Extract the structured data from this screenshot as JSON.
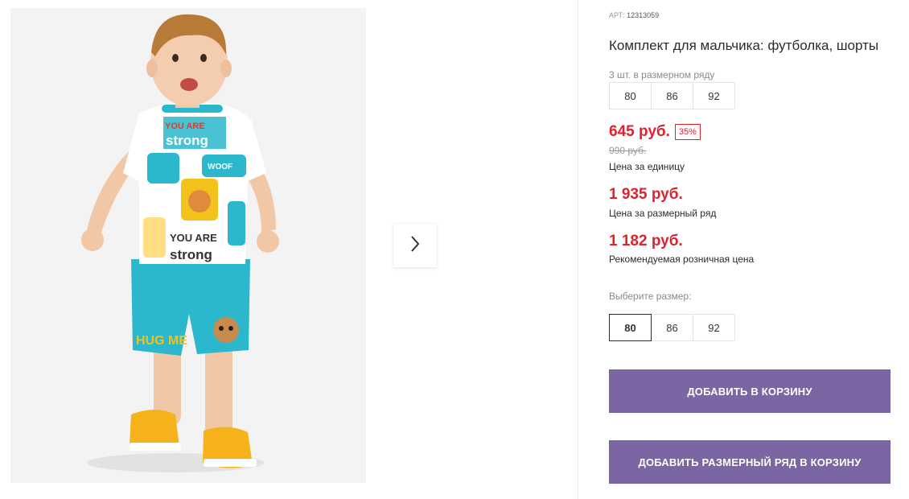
{
  "product": {
    "sku_label": "АРТ:",
    "sku_value": "12313059",
    "title": "Комплект для мальчика: футболка, шорты",
    "pack_note": "3 шт. в размерном ряду",
    "pack_sizes": [
      "80",
      "86",
      "92"
    ],
    "price": "645 руб.",
    "discount": "35%",
    "old_price": "990 руб.",
    "unit_caption": "Цена за единицу",
    "row_price": "1 935 руб.",
    "row_caption": "Цена за размерный ряд",
    "retail_price": "1 182 руб.",
    "retail_caption": "Рекомендуемая розничная цена",
    "choose_size_label": "Выберите размер:",
    "size_options": [
      "80",
      "86",
      "92"
    ],
    "selected_size": "80",
    "add_to_cart": "Добавить в корзину",
    "add_row_to_cart": "Добавить размерный ряд в корзину"
  },
  "gallery": {
    "next_icon": "chevron-right-icon"
  },
  "colors": {
    "price_red": "#e0222f",
    "button_purple": "#7b66a3",
    "shorts_teal": "#2bb7cc",
    "shoe_yellow": "#f6b21a"
  }
}
